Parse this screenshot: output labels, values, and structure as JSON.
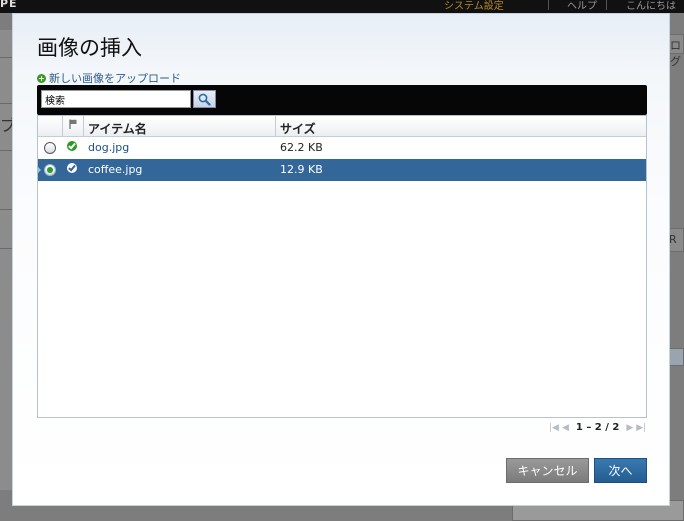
{
  "background": {
    "logo": "PE",
    "nav": [
      "システム設定",
      "ヘルプ",
      "こんにちは"
    ],
    "fragments": [
      "ブ",
      "ログ",
      "R"
    ]
  },
  "dialog": {
    "title": "画像の挿入",
    "upload_link": "新しい画像をアップロード",
    "search": {
      "value": "検索",
      "placeholder": "検索"
    },
    "columns": {
      "name": "アイテム名",
      "size": "サイズ"
    },
    "rows": [
      {
        "name": "dog.jpg",
        "size": "62.2 KB",
        "selected": false
      },
      {
        "name": "coffee.jpg",
        "size": "12.9 KB",
        "selected": true
      }
    ],
    "pager": {
      "text": "1 – 2 / 2"
    },
    "buttons": {
      "cancel": "キャンセル",
      "next": "次へ"
    },
    "colors": {
      "selected_row": "#336699",
      "status_ok": "#2a9a25",
      "next_button": "#2b6aa1",
      "cancel_button": "#8a8a8a"
    },
    "icons": [
      "plus-circle-icon",
      "search-icon",
      "flag-icon",
      "check-circle-icon",
      "radio-icon",
      "pager-first-icon",
      "pager-prev-icon",
      "pager-next-icon",
      "pager-last-icon"
    ]
  }
}
